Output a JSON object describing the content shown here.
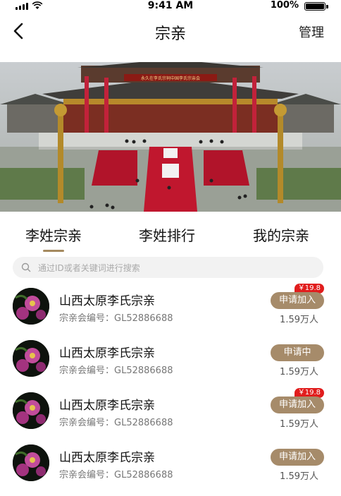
{
  "status_bar": {
    "time": "9:41 AM",
    "battery": "100%"
  },
  "nav": {
    "title": "宗亲",
    "manage_label": "管理"
  },
  "banner": {
    "sign_text": "永久在李氏宗祠中国李氏宗亲会"
  },
  "tabs": [
    {
      "label": "李姓宗亲",
      "active": true
    },
    {
      "label": "李姓排行",
      "active": false
    },
    {
      "label": "我的宗亲",
      "active": false
    }
  ],
  "search": {
    "placeholder": "通过ID或者关键词进行搜索"
  },
  "items": [
    {
      "name": "山西太原李氏宗亲",
      "number": "宗亲会编号：GL52886688",
      "action": "申请加入",
      "badge": "￥19.8",
      "count": "1.59万人"
    },
    {
      "name": "山西太原李氏宗亲",
      "number": "宗亲会编号：GL52886688",
      "action": "申请中",
      "badge": "",
      "count": "1.59万人"
    },
    {
      "name": "山西太原李氏宗亲",
      "number": "宗亲会编号：GL52886688",
      "action": "申请加入",
      "badge": "￥19.8",
      "count": "1.59万人"
    },
    {
      "name": "山西太原李氏宗亲",
      "number": "宗亲会编号：GL52886688",
      "action": "申请加入",
      "badge": "",
      "count": "1.59万人"
    }
  ],
  "colors": {
    "accent": "#a68b6a",
    "badge": "#e11d1d",
    "tab_indicator": "#a58a5f"
  }
}
